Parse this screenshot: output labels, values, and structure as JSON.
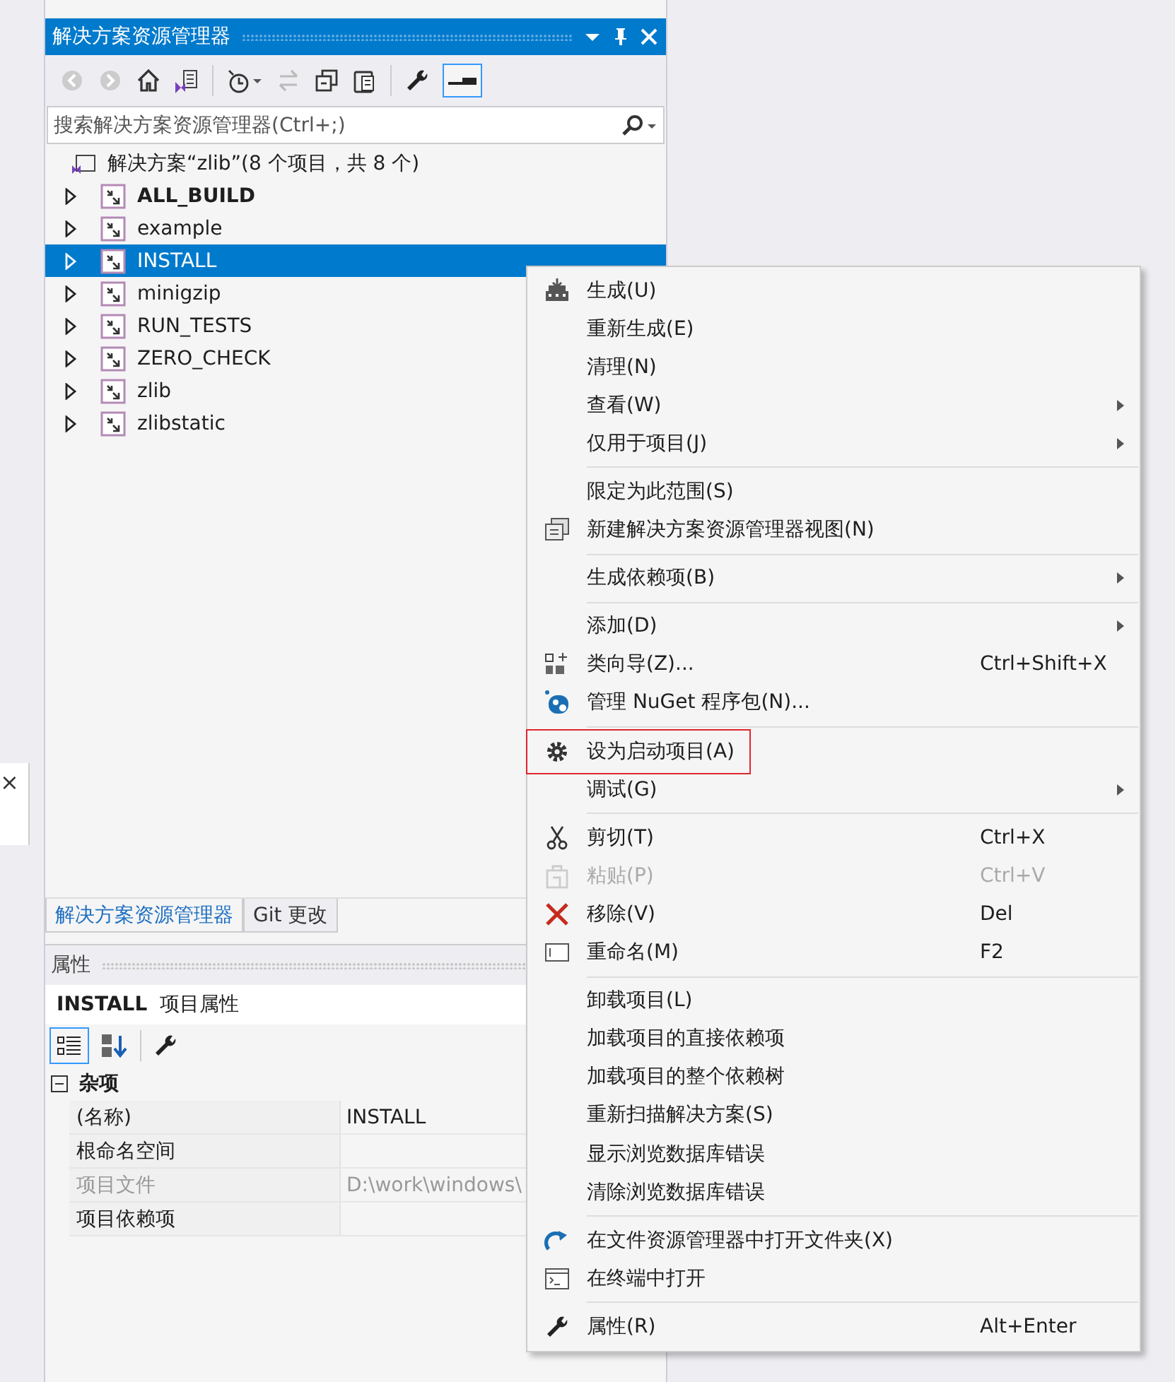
{
  "side_window": {
    "close": "×"
  },
  "solution_explorer": {
    "title": "解决方案资源管理器",
    "search": {
      "placeholder": "搜索解决方案资源管理器(Ctrl+;)"
    },
    "solution": "解决方案“zlib”(8 个项目，共 8 个)",
    "projects": [
      {
        "name": "ALL_BUILD",
        "bold": true,
        "selected": false
      },
      {
        "name": "example",
        "bold": false,
        "selected": false
      },
      {
        "name": "INSTALL",
        "bold": false,
        "selected": true
      },
      {
        "name": "minigzip",
        "bold": false,
        "selected": false
      },
      {
        "name": "RUN_TESTS",
        "bold": false,
        "selected": false
      },
      {
        "name": "ZERO_CHECK",
        "bold": false,
        "selected": false
      },
      {
        "name": "zlib",
        "bold": false,
        "selected": false
      },
      {
        "name": "zlibstatic",
        "bold": false,
        "selected": false
      }
    ],
    "tabs": [
      {
        "label": "解决方案资源管理器",
        "selected": true
      },
      {
        "label": "Git 更改",
        "selected": false
      }
    ]
  },
  "properties": {
    "title": "属性",
    "object_name": "INSTALL",
    "object_type": "项目属性",
    "category": "杂项",
    "expanded": true,
    "rows": [
      {
        "name": "(名称)",
        "value": "INSTALL",
        "disabled": false
      },
      {
        "name": "根命名空间",
        "disabled": false
      },
      {
        "name": "项目文件",
        "value": "D:\\work\\windows\\",
        "disabled": true
      },
      {
        "name": "项目依赖项",
        "disabled": false
      }
    ]
  },
  "context_menu": [
    {
      "kind": "item",
      "label": "生成(U)"
    },
    {
      "kind": "item",
      "label": "重新生成(E)"
    },
    {
      "kind": "item",
      "label": "清理(N)"
    },
    {
      "kind": "item",
      "label": "查看(W)",
      "submenu": true
    },
    {
      "kind": "item",
      "label": "仅用于项目(J)",
      "submenu": true
    },
    {
      "kind": "separator"
    },
    {
      "kind": "item",
      "label": "限定为此范围(S)"
    },
    {
      "kind": "item",
      "label": "新建解决方案资源管理器视图(N)"
    },
    {
      "kind": "separator"
    },
    {
      "kind": "item",
      "label": "生成依赖项(B)",
      "submenu": true
    },
    {
      "kind": "separator"
    },
    {
      "kind": "item",
      "label": "添加(D)",
      "submenu": true
    },
    {
      "kind": "item",
      "label": "类向导(Z)...",
      "shortcut": "Ctrl+Shift+X"
    },
    {
      "kind": "item",
      "label": "管理 NuGet 程序包(N)..."
    },
    {
      "kind": "separator"
    },
    {
      "kind": "item",
      "label": "设为启动项目(A)",
      "highlighted": true
    },
    {
      "kind": "item",
      "label": "调试(G)",
      "submenu": true
    },
    {
      "kind": "separator"
    },
    {
      "kind": "item",
      "label": "剪切(T)",
      "shortcut": "Ctrl+X"
    },
    {
      "kind": "item",
      "label": "粘贴(P)",
      "shortcut": "Ctrl+V",
      "disabled": true
    },
    {
      "kind": "item",
      "label": "移除(V)",
      "shortcut": "Del"
    },
    {
      "kind": "item",
      "label": "重命名(M)",
      "shortcut": "F2"
    },
    {
      "kind": "separator"
    },
    {
      "kind": "item",
      "label": "卸载项目(L)"
    },
    {
      "kind": "item",
      "label": "加载项目的直接依赖项"
    },
    {
      "kind": "item",
      "label": "加载项目的整个依赖树"
    },
    {
      "kind": "item",
      "label": "重新扫描解决方案(S)"
    },
    {
      "kind": "item",
      "label": "显示浏览数据库错误"
    },
    {
      "kind": "item",
      "label": "清除浏览数据库错误"
    },
    {
      "kind": "separator"
    },
    {
      "kind": "item",
      "label": "在文件资源管理器中打开文件夹(X)"
    },
    {
      "kind": "item",
      "label": "在终端中打开"
    },
    {
      "kind": "separator"
    },
    {
      "kind": "item",
      "label": "属性(R)",
      "shortcut": "Alt+Enter"
    }
  ]
}
